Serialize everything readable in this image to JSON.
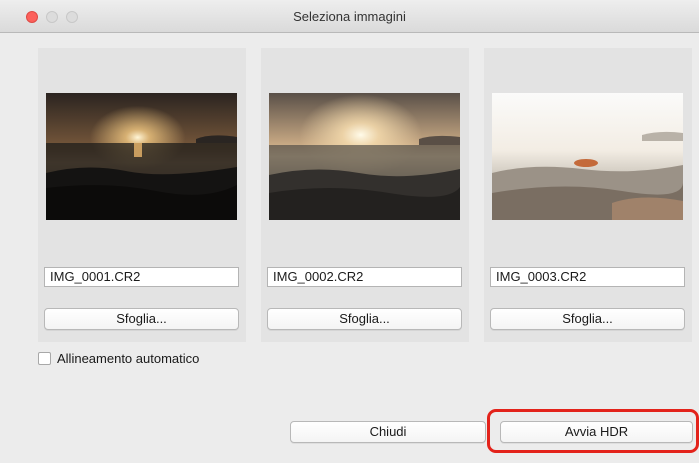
{
  "window": {
    "title": "Seleziona immagini"
  },
  "images": [
    {
      "filename": "IMG_0001.CR2",
      "browse_label": "Sfoglia...",
      "thumbnail": "dark-sunset-sea"
    },
    {
      "filename": "IMG_0002.CR2",
      "browse_label": "Sfoglia...",
      "thumbnail": "mid-sunset-sea"
    },
    {
      "filename": "IMG_0003.CR2",
      "browse_label": "Sfoglia...",
      "thumbnail": "bright-overexposed-sea"
    }
  ],
  "auto_align": {
    "label": "Allineamento automatico",
    "checked": false
  },
  "footer": {
    "close_label": "Chiudi",
    "start_label": "Avvia HDR"
  },
  "colors": {
    "highlight": "#e3231b",
    "close_light": "#fc605b"
  }
}
